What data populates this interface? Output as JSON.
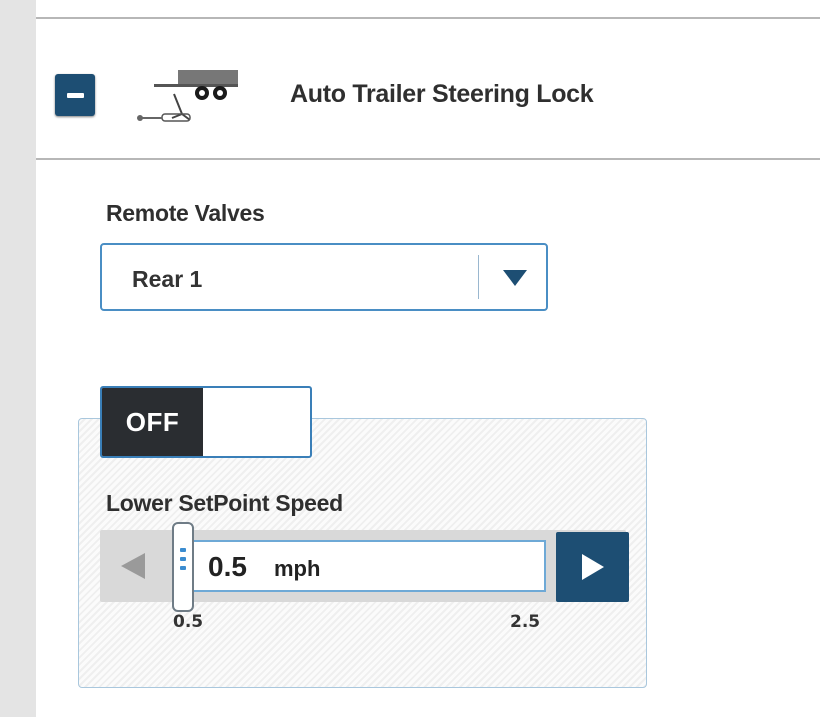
{
  "header": {
    "title": "Auto Trailer Steering Lock",
    "collapse_icon": "minus-icon",
    "feature_icon": "trailer-hitch-icon"
  },
  "remote_valves": {
    "label": "Remote Valves",
    "selected": "Rear 1",
    "dropdown_icon": "triangle-down-icon"
  },
  "toggle": {
    "state_label": "OFF",
    "is_on": false
  },
  "lower_setpoint": {
    "label": "Lower SetPoint Speed",
    "value": "0.5",
    "unit": "mph",
    "min_label": "0.5",
    "max_label": "2.5",
    "min": 0.5,
    "max": 2.5,
    "current": 0.5
  },
  "colors": {
    "accent_dark": "#1d4e73",
    "accent_border": "#4a8ec4",
    "toggle_off_bg": "#2a2d31"
  }
}
